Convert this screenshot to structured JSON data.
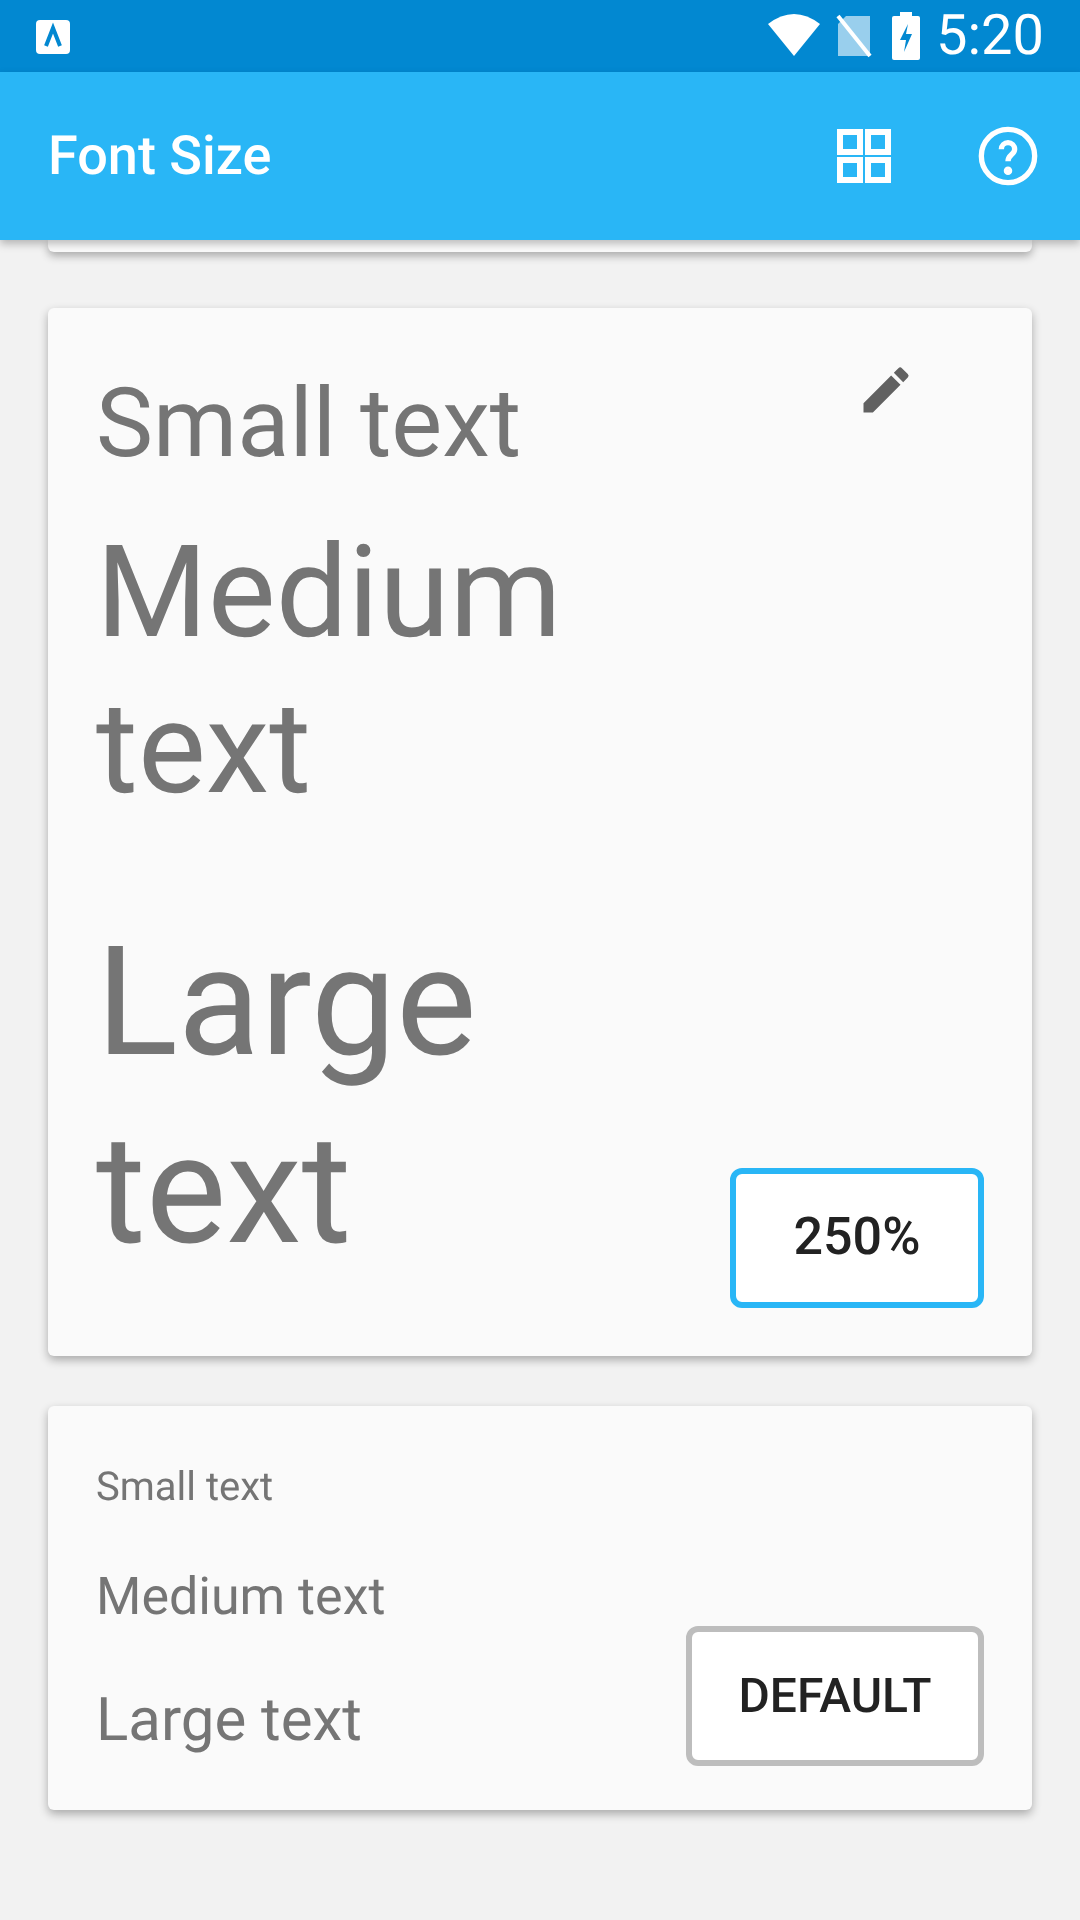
{
  "status_bar": {
    "time": "5:20"
  },
  "app_bar": {
    "title": "Font Size"
  },
  "cards": [
    {
      "samples": [
        {
          "kind": "small",
          "text": "Small text"
        },
        {
          "kind": "medium",
          "text": "Medium text"
        },
        {
          "kind": "large",
          "text": "Large text"
        }
      ],
      "button": "250%",
      "editable": true,
      "kind": "big",
      "selected": true
    },
    {
      "samples": [
        {
          "kind": "small",
          "text": "Small text"
        },
        {
          "kind": "medium",
          "text": "Medium text"
        },
        {
          "kind": "large",
          "text": "Large text"
        }
      ],
      "button": "DEFAULT",
      "editable": false,
      "kind": "normal",
      "selected": false
    }
  ]
}
